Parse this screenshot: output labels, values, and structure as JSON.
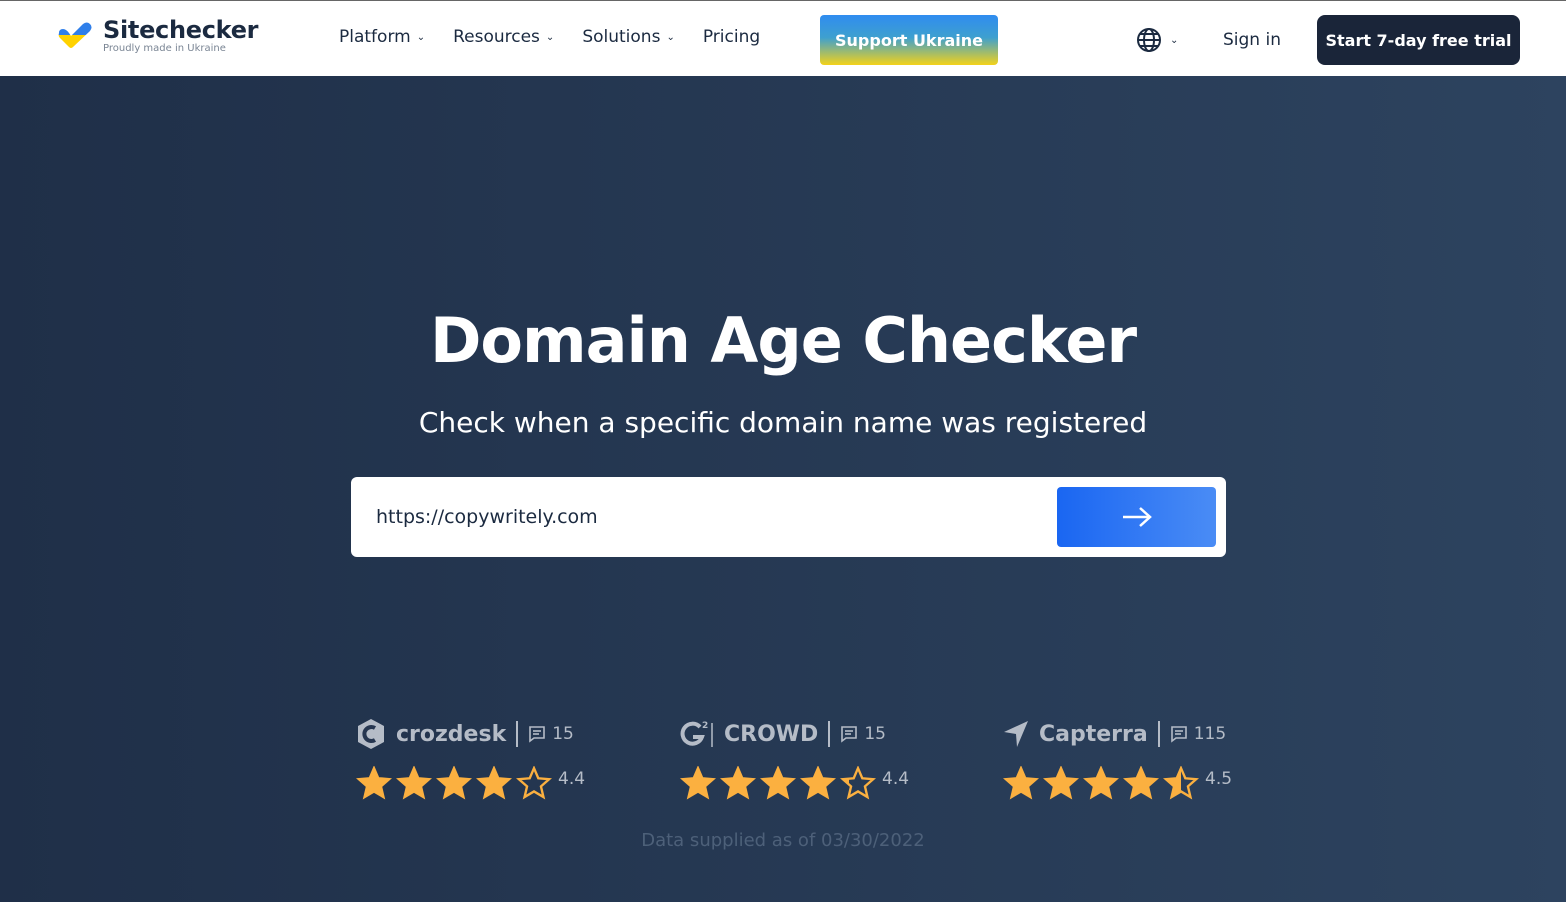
{
  "header": {
    "logo_name": "Sitechecker",
    "logo_tagline": "Proudly made in Ukraine",
    "menu": [
      {
        "label": "Platform",
        "dropdown": true
      },
      {
        "label": "Resources",
        "dropdown": true
      },
      {
        "label": "Solutions",
        "dropdown": true
      },
      {
        "label": "Pricing",
        "dropdown": false
      }
    ],
    "support_label": "Support Ukraine",
    "sign_in": "Sign in",
    "trial_label": "Start 7-day free trial"
  },
  "hero": {
    "title": "Domain Age Checker",
    "subtitle": "Check when a specific domain name was registered",
    "input_value": "https://copywritely.com"
  },
  "ratings": [
    {
      "brand": "crozdesk",
      "reviews": "15",
      "score": "4.4",
      "fill": 4.0
    },
    {
      "brand": "CROWD",
      "reviews": "15",
      "score": "4.4",
      "fill": 4.2
    },
    {
      "brand": "Capterra",
      "reviews": "115",
      "score": "4.5",
      "fill": 4.5
    }
  ],
  "supplied": "Data supplied as of 03/30/2022",
  "colors": {
    "star": "#fbb040",
    "cta": "#1a66f2",
    "dark": "#1a2539"
  }
}
